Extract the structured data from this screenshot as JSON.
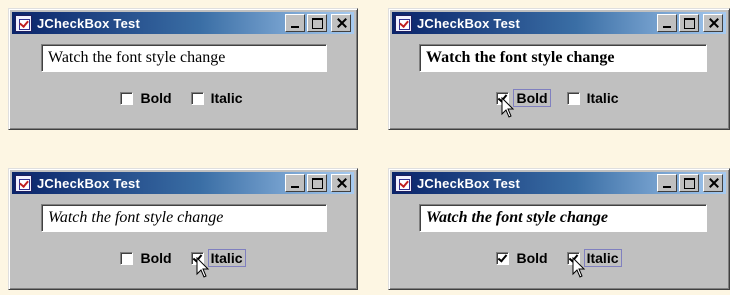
{
  "windows": [
    {
      "title": "JCheckBox Test",
      "field_text": "Watch the font style change",
      "bold": {
        "label": "Bold",
        "checked": false
      },
      "italic": {
        "label": "Italic",
        "checked": false
      }
    },
    {
      "title": "JCheckBox Test",
      "field_text": "Watch the font style change",
      "bold": {
        "label": "Bold",
        "checked": true
      },
      "italic": {
        "label": "Italic",
        "checked": false
      }
    },
    {
      "title": "JCheckBox Test",
      "field_text": "Watch the font style change",
      "bold": {
        "label": "Bold",
        "checked": false
      },
      "italic": {
        "label": "Italic",
        "checked": true
      }
    },
    {
      "title": "JCheckBox Test",
      "field_text": "Watch the font style change",
      "bold": {
        "label": "Bold",
        "checked": true
      },
      "italic": {
        "label": "Italic",
        "checked": true
      }
    }
  ],
  "icons": {
    "app": "java-cup-icon",
    "minimize": "minimize-icon",
    "maximize": "maximize-icon",
    "close": "close-icon",
    "cursor": "mouse-pointer-icon"
  }
}
